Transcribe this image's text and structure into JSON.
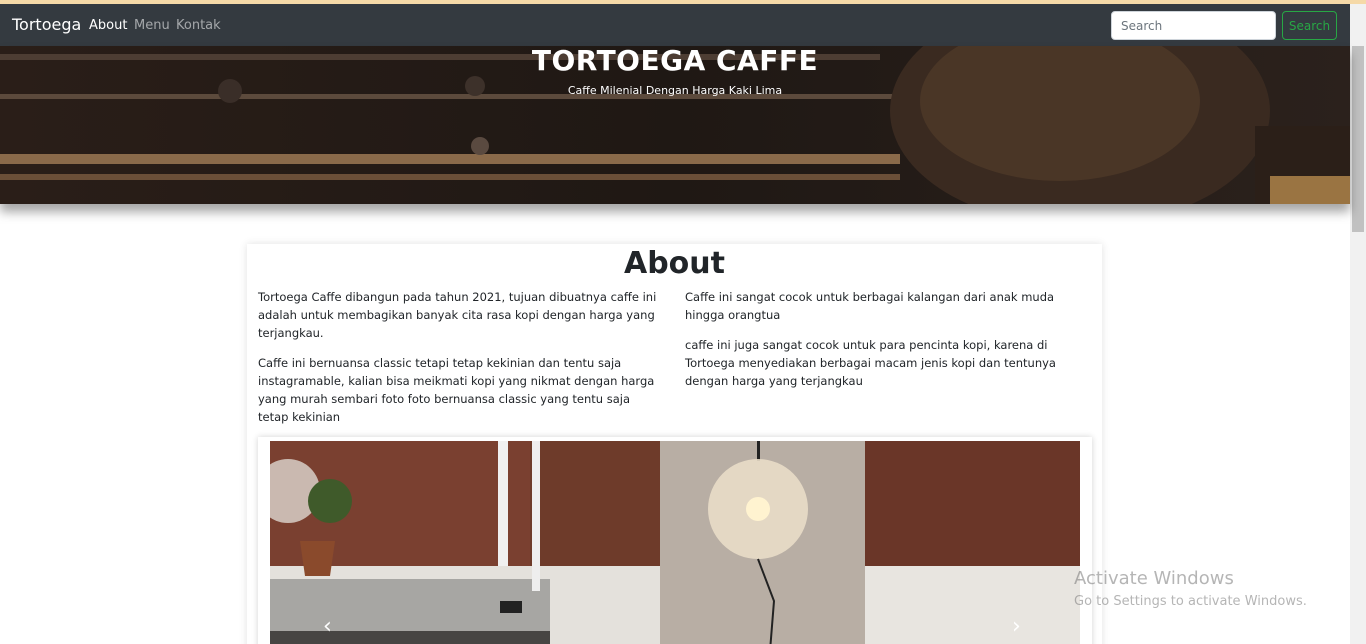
{
  "navbar": {
    "brand": "Tortoega",
    "links": [
      "About",
      "Menu",
      "Kontak"
    ],
    "search_placeholder": "Search",
    "search_button": "Search"
  },
  "hero": {
    "title": "TORTOEGA CAFFE",
    "subtitle": "Caffe Milenial Dengan Harga Kaki Lima"
  },
  "about": {
    "title": "About",
    "left": [
      "Tortoega Caffe dibangun pada tahun 2021, tujuan dibuatnya caffe ini adalah untuk membagikan banyak cita rasa kopi dengan harga yang terjangkau.",
      "Caffe ini bernuansa classic tetapi tetap kekinian dan tentu saja instagramable, kalian bisa meikmati kopi yang nikmat dengan harga yang murah sembari foto foto bernuansa classic yang tentu saja tetap kekinian"
    ],
    "right": [
      "Caffe ini sangat cocok untuk berbagai kalangan dari anak muda hingga orangtua",
      "caffe ini juga sangat cocok untuk para pencinta kopi, karena di Tortoega menyediakan berbagai macam jenis kopi dan tentunya dengan harga yang terjangkau"
    ]
  },
  "carousel": {
    "prev_icon": "chevron-left-icon",
    "next_icon": "chevron-right-icon"
  },
  "watermark": {
    "line1": "Activate Windows",
    "line2": "Go to Settings to activate Windows."
  },
  "colors": {
    "navbar_bg": "#343a40",
    "success": "#28a745",
    "top_strip": "#f5d9a8"
  }
}
